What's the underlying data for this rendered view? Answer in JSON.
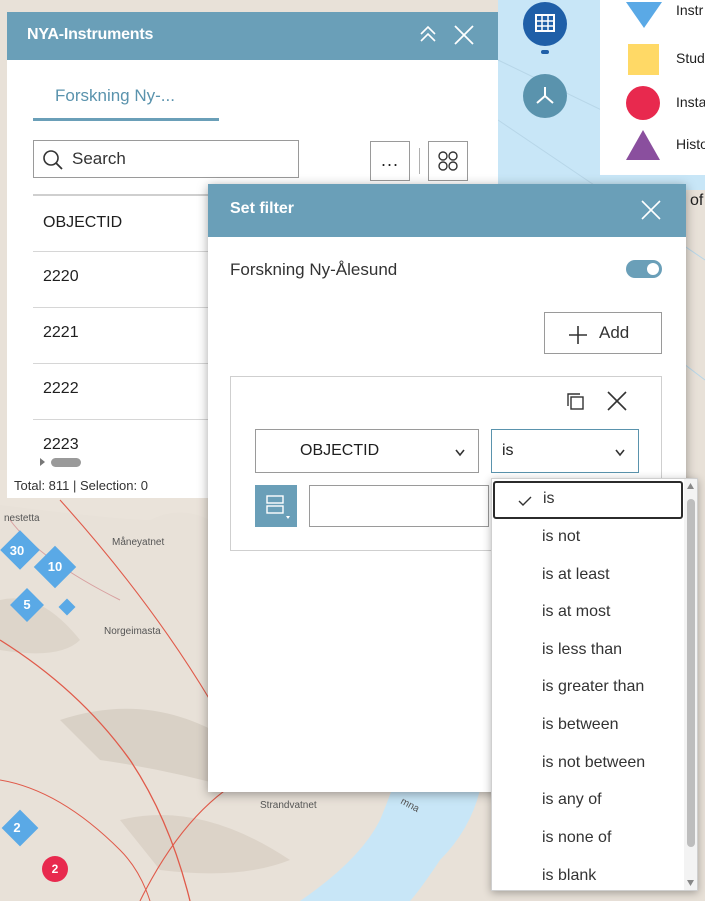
{
  "panel": {
    "title": "NYA-Instruments",
    "tab_label": "Forskning Ny-...",
    "search_placeholder": "Search",
    "more_label": "...",
    "column_header": "OBJECTID",
    "rows": [
      "2220",
      "2221",
      "2222",
      "2223"
    ],
    "status": "Total: 811 | Selection: 0"
  },
  "legend": {
    "items": [
      {
        "label": "Instr",
        "icon": "triangle-down-icon",
        "color": "#5aa9e6"
      },
      {
        "label": "Stud",
        "icon": "square-icon",
        "color": "#ffd966"
      },
      {
        "label": "Insta",
        "icon": "circle-icon",
        "color": "#e8294e"
      },
      {
        "label": "Histo",
        "icon": "triangle-up-icon",
        "color": "#8a4f9e"
      }
    ],
    "partial_text": "of"
  },
  "map": {
    "places": [
      "nestetta",
      "Måneyatnet",
      "Norgeimasta",
      "Strandvatnet",
      "mna"
    ],
    "clusters": [
      "30",
      "10",
      "5",
      "2"
    ],
    "red_cluster": "2"
  },
  "dialog": {
    "title": "Set filter",
    "layer_name": "Forskning Ny-Ålesund",
    "add_label": "Add",
    "field_value": "OBJECTID",
    "operator_value": "is",
    "value_input": ""
  },
  "dropdown": {
    "options": [
      "is",
      "is not",
      "is at least",
      "is at most",
      "is less than",
      "is greater than",
      "is between",
      "is not between",
      "is any of",
      "is none of",
      "is blank"
    ],
    "selected_index": 0
  },
  "colors": {
    "accent": "#6a9fb8",
    "water": "#c8e6f7",
    "cluster": "#5aa9e6"
  }
}
